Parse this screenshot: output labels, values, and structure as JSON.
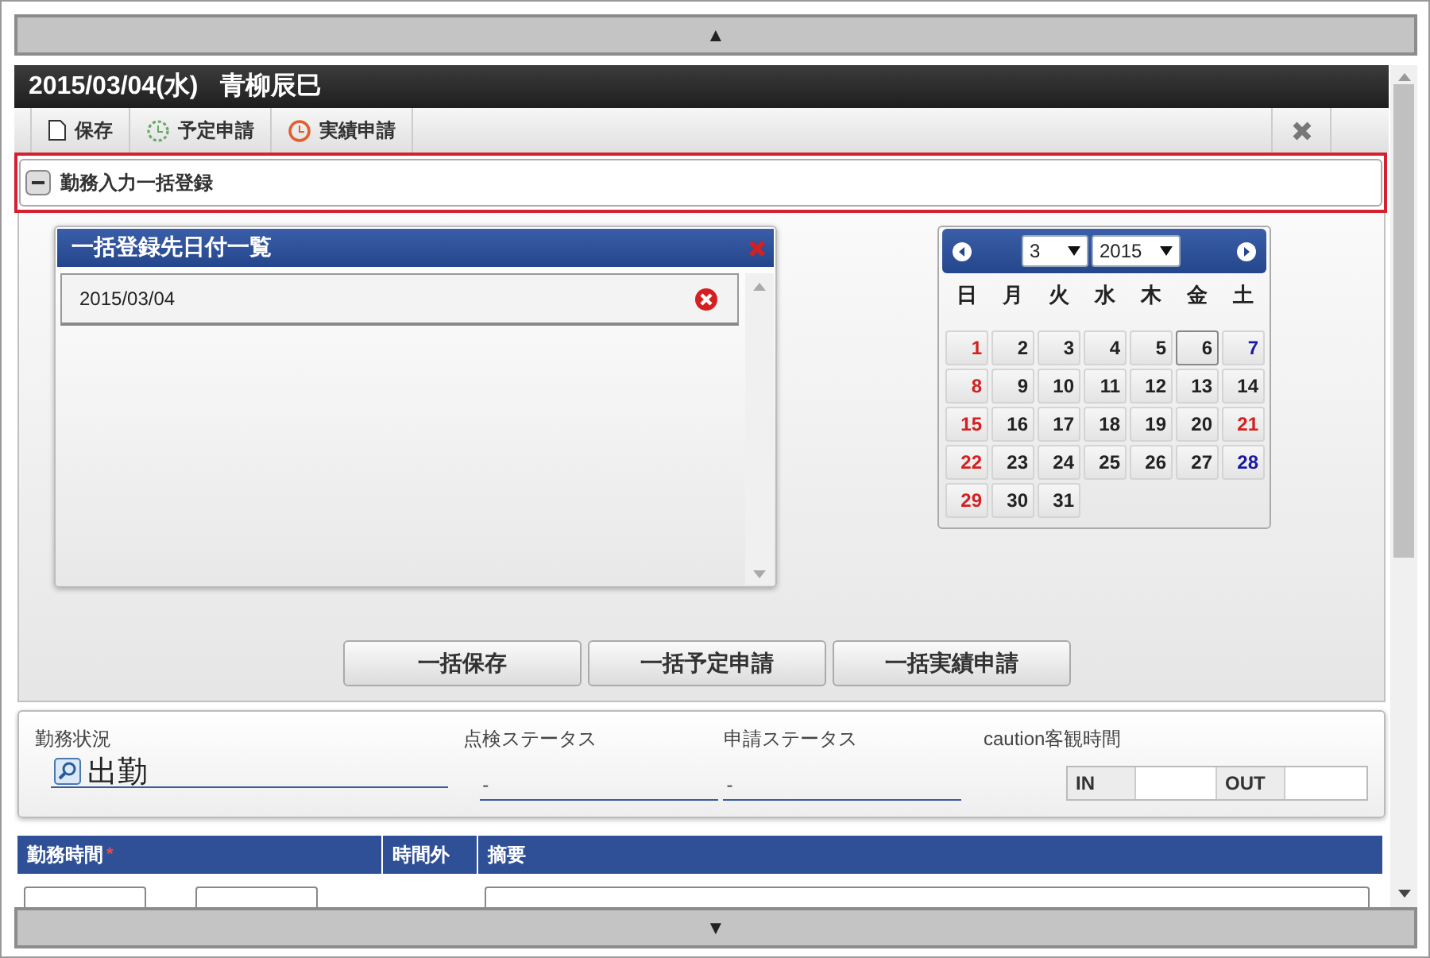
{
  "top_bar": {
    "arrow": "▲"
  },
  "dialog": {
    "date": "2015/03/04(水)",
    "name": "青柳辰巳",
    "toolbar": [
      {
        "kind": "save",
        "label": "保存"
      },
      {
        "kind": "plan",
        "label": "予定申請"
      },
      {
        "kind": "actual",
        "label": "実績申請"
      }
    ],
    "section": {
      "title": "勤務入力一括登録",
      "expanded": true,
      "highlighted": true
    },
    "date_list": {
      "title": "一括登録先日付一覧",
      "items": [
        "2015/03/04"
      ]
    },
    "calendar": {
      "month": "3",
      "year": "2015",
      "weekdays": [
        "日",
        "月",
        "火",
        "水",
        "木",
        "金",
        "土"
      ],
      "days": [
        {
          "label": "1",
          "color": "#d42020",
          "highlighted": false
        },
        {
          "label": "2",
          "color": "#222222",
          "highlighted": false
        },
        {
          "label": "3",
          "color": "#222222",
          "highlighted": false
        },
        {
          "label": "4",
          "color": "#222222",
          "highlighted": false
        },
        {
          "label": "5",
          "color": "#222222",
          "highlighted": false
        },
        {
          "label": "6",
          "color": "#222222",
          "highlighted": true
        },
        {
          "label": "7",
          "color": "#1a1aa0",
          "highlighted": false
        },
        {
          "label": "8",
          "color": "#d42020",
          "highlighted": false
        },
        {
          "label": "9",
          "color": "#222222",
          "highlighted": false
        },
        {
          "label": "10",
          "color": "#222222",
          "highlighted": false
        },
        {
          "label": "11",
          "color": "#222222",
          "highlighted": false
        },
        {
          "label": "12",
          "color": "#222222",
          "highlighted": false
        },
        {
          "label": "13",
          "color": "#222222",
          "highlighted": false
        },
        {
          "label": "14",
          "color": "#222222",
          "highlighted": false
        },
        {
          "label": "15",
          "color": "#d42020",
          "highlighted": false
        },
        {
          "label": "16",
          "color": "#222222",
          "highlighted": false
        },
        {
          "label": "17",
          "color": "#222222",
          "highlighted": false
        },
        {
          "label": "18",
          "color": "#222222",
          "highlighted": false
        },
        {
          "label": "19",
          "color": "#222222",
          "highlighted": false
        },
        {
          "label": "20",
          "color": "#222222",
          "highlighted": false
        },
        {
          "label": "21",
          "color": "#d42020",
          "highlighted": false
        },
        {
          "label": "22",
          "color": "#d42020",
          "highlighted": false
        },
        {
          "label": "23",
          "color": "#222222",
          "highlighted": false
        },
        {
          "label": "24",
          "color": "#222222",
          "highlighted": false
        },
        {
          "label": "25",
          "color": "#222222",
          "highlighted": false
        },
        {
          "label": "26",
          "color": "#222222",
          "highlighted": false
        },
        {
          "label": "27",
          "color": "#222222",
          "highlighted": false
        },
        {
          "label": "28",
          "color": "#1a1aa0",
          "highlighted": false
        },
        {
          "label": "29",
          "color": "#d42020",
          "highlighted": false
        },
        {
          "label": "30",
          "color": "#222222",
          "highlighted": false
        },
        {
          "label": "31",
          "color": "#222222",
          "highlighted": false
        }
      ]
    },
    "buttons": [
      "一括保存",
      "一括予定申請",
      "一括実績申請"
    ],
    "status": {
      "work_status": {
        "label": "勤務状況",
        "value": "出勤"
      },
      "check_status": {
        "label": "点検ステータス",
        "value": "-"
      },
      "request_status": {
        "label": "申請ステータス",
        "value": "-"
      },
      "objective_time": {
        "label": "caution客観時間",
        "in_label": "IN",
        "out_label": "OUT"
      }
    },
    "table": {
      "columns": [
        {
          "label": "勤務時間",
          "required_mark": "*"
        },
        {
          "label": "時間外"
        },
        {
          "label": "摘要"
        }
      ]
    }
  },
  "bottom_bar": {
    "arrow": "▼"
  }
}
